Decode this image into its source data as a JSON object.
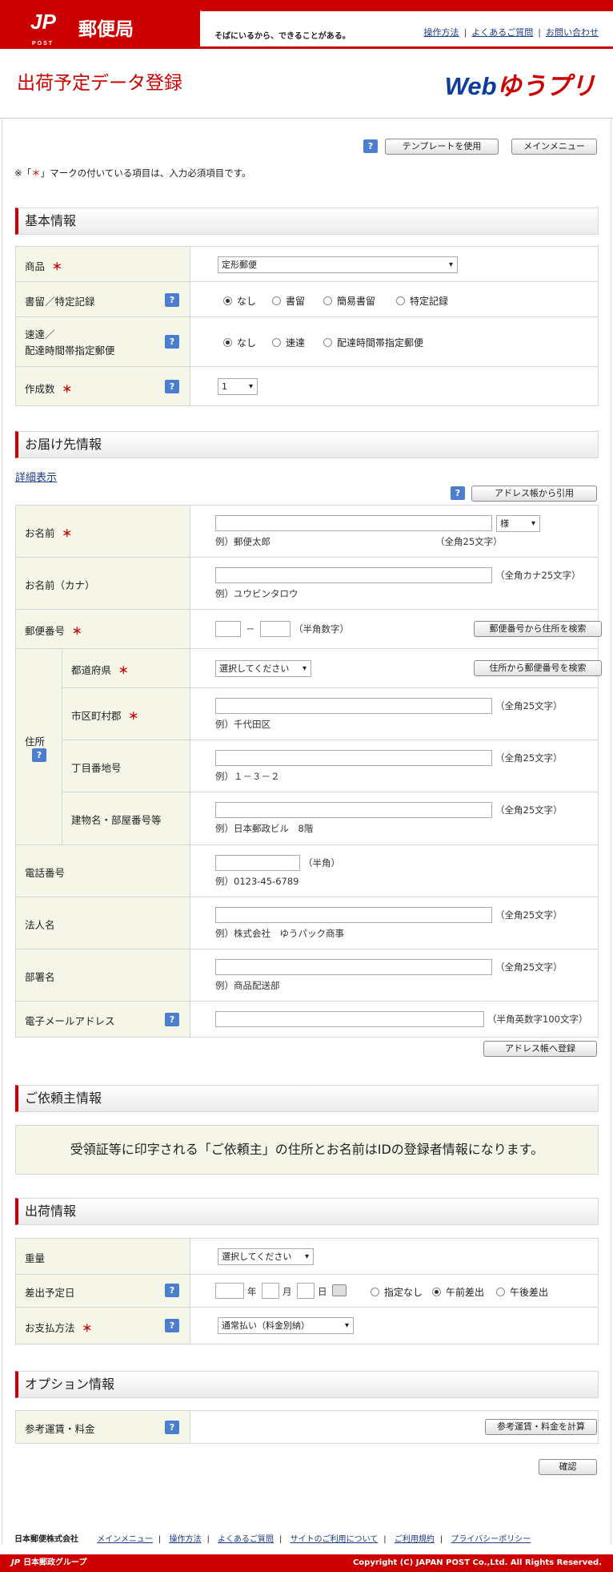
{
  "header": {
    "logo_mark": "JP",
    "logo_sub": "POST",
    "brand": "郵便局",
    "slogan": "そばにいるから、できることがある。",
    "links": [
      "操作方法",
      "よくあるご質問",
      "お問い合わせ"
    ]
  },
  "page_title": "出荷予定データ登録",
  "service_logo": {
    "a": "Web",
    "b": "ゆうプリ"
  },
  "toolbar": {
    "help": "?",
    "template_label": "テンプレートを使用",
    "menu_label": "メインメニュー"
  },
  "required_note": {
    "pre": "※「",
    "mark": "＊",
    "post": "」マークの付いている項目は、入力必須項目です。"
  },
  "basic": {
    "heading": "基本情報",
    "product_label": "商品",
    "product_value": "定形郵便",
    "registered_label": "書留／特定記録",
    "registered_options": [
      "なし",
      "書留",
      "簡易書留",
      "特定記録"
    ],
    "express_label1": "速達／",
    "express_label2": "配達時間帯指定郵便",
    "express_options": [
      "なし",
      "速達",
      "配達時間帯指定郵便"
    ],
    "count_label": "作成数",
    "count_value": "1"
  },
  "dest": {
    "heading": "お届け先情報",
    "detail_link": "詳細表示",
    "address_book_label": "アドレス帳から引用",
    "name_label": "お名前",
    "honorific": "様",
    "name_example": "例）郵便太郎",
    "name_hint": "（全角25文字）",
    "kana_label": "お名前（カナ）",
    "kana_hint": "（全角カナ25文字）",
    "kana_example": "例）ユウビンタロウ",
    "zip_label": "郵便番号",
    "zip_dash": "－",
    "zip_hint": "（半角数字）",
    "zip_search_label": "郵便番号から住所を検索",
    "address_label": "住所",
    "pref_label": "都道府県",
    "pref_value": "選択してください",
    "addr_search_label": "住所から郵便番号を検索",
    "city_label": "市区町村郡",
    "city_hint": "（全角25文字）",
    "city_example": "例）千代田区",
    "street_label": "丁目番地号",
    "street_hint": "（全角25文字）",
    "street_example": "例）１－３－２",
    "building_label": "建物名・部屋番号等",
    "building_hint": "（全角25文字）",
    "building_example": "例）日本郵政ビル　8階",
    "phone_label": "電話番号",
    "phone_hint": "（半角）",
    "phone_example": "例）0123-45-6789",
    "corp_label": "法人名",
    "corp_hint": "（全角25文字）",
    "corp_example": "例）株式会社　ゆうパック商事",
    "dept_label": "部署名",
    "dept_hint": "（全角25文字）",
    "dept_example": "例）商品配送部",
    "email_label": "電子メールアドレス",
    "email_hint": "（半角英数字100文字）",
    "register_label": "アドレス帳へ登録"
  },
  "sender": {
    "heading": "ご依頼主情報",
    "message": "受領証等に印字される「ご依頼主」の住所とお名前はIDの登録者情報になります。"
  },
  "ship": {
    "heading": "出荷情報",
    "weight_label": "重量",
    "weight_value": "選択してください",
    "date_label": "差出予定日",
    "year": "年",
    "month": "月",
    "day": "日",
    "time_options": [
      "指定なし",
      "午前差出",
      "午後差出"
    ],
    "pay_label": "お支払方法",
    "pay_value": "通常払い（料金別納）"
  },
  "option": {
    "heading": "オプション情報",
    "fee_label": "参考運賃・料金",
    "calc_label": "参考運賃・料金を計算"
  },
  "confirm_label": "確認",
  "footer": {
    "company": "日本郵便株式会社",
    "links": [
      "メインメニュー",
      "操作方法",
      "よくあるご質問",
      "サイトのご利用について",
      "ご利用規約",
      "プライバシーポリシー"
    ],
    "group": "日本郵政グループ",
    "copyright": "Copyright (C) JAPAN POST Co.,Ltd.  All Rights Reserved."
  },
  "colors": {
    "brand_red": "#cc0000",
    "label_bg": "#f5f5e8",
    "help_blue": "#4c7ed0",
    "link": "#1a3a8a"
  }
}
